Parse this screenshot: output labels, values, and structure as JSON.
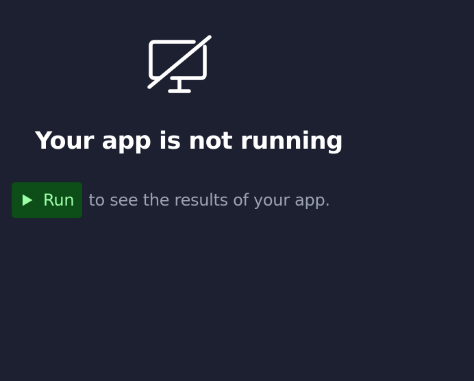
{
  "empty_state": {
    "icon": "monitor-off-icon",
    "title": "Your app is not running",
    "run_button": {
      "icon": "play-icon",
      "label": "Run"
    },
    "hint": "to see the results of your app."
  },
  "colors": {
    "background": "#1c2030",
    "title": "#ffffff",
    "hint": "#9da2b3",
    "run_button_bg": "#0d4d17",
    "run_button_fg": "#9dfea8"
  }
}
